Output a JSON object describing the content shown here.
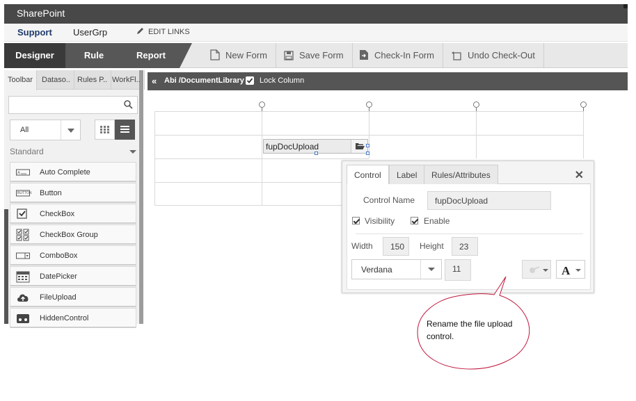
{
  "app": {
    "title": "SharePoint"
  },
  "nav": {
    "items": [
      "Support",
      "UserGrp"
    ],
    "edit_links": "EDIT LINKS"
  },
  "ribbon": {
    "tabs": [
      "Designer",
      "Rule",
      "Report"
    ],
    "buttons": [
      "New Form",
      "Save Form",
      "Check-In Form",
      "Undo Check-Out"
    ]
  },
  "sidebar": {
    "tabs": [
      "Toolbar",
      "Dataso..",
      "Rules P..",
      "WorkFl.."
    ],
    "search_placeholder": "",
    "filter_value": "All",
    "section": "Standard",
    "tools": [
      {
        "label": "Auto Complete",
        "icon": "autocomplete-icon"
      },
      {
        "label": "Button",
        "icon": "button-icon",
        "icon_text": "BUTTON"
      },
      {
        "label": "CheckBox",
        "icon": "checkbox-icon"
      },
      {
        "label": "CheckBox Group",
        "icon": "checkbox-group-icon"
      },
      {
        "label": "ComboBox",
        "icon": "combobox-icon"
      },
      {
        "label": "DatePicker",
        "icon": "calendar-icon"
      },
      {
        "label": "FileUpload",
        "icon": "cloud-upload-icon"
      },
      {
        "label": "HiddenControl",
        "icon": "hidden-control-icon"
      }
    ]
  },
  "canvas": {
    "path": "Abi /DocumentLibrary",
    "lock_column_label": "Lock Column",
    "control_label": "fupDocUpload"
  },
  "panel": {
    "tabs": [
      "Control",
      "Label",
      "Rules/Attributes"
    ],
    "control_name_label": "Control Name",
    "control_name_value": "fupDocUpload",
    "visibility_label": "Visibility",
    "enable_label": "Enable",
    "width_label": "Width",
    "width_value": "150",
    "height_label": "Height",
    "height_value": "23",
    "font_value": "Verdana",
    "font_size_value": "11"
  },
  "callout": {
    "text": "Rename the file upload control."
  },
  "colors": {
    "topbar": "#484848",
    "ribbon_active": "#3a3a3a",
    "ribbon_tab": "#575757",
    "support_link": "#1f3a6b",
    "callout_border": "#c0143c"
  }
}
